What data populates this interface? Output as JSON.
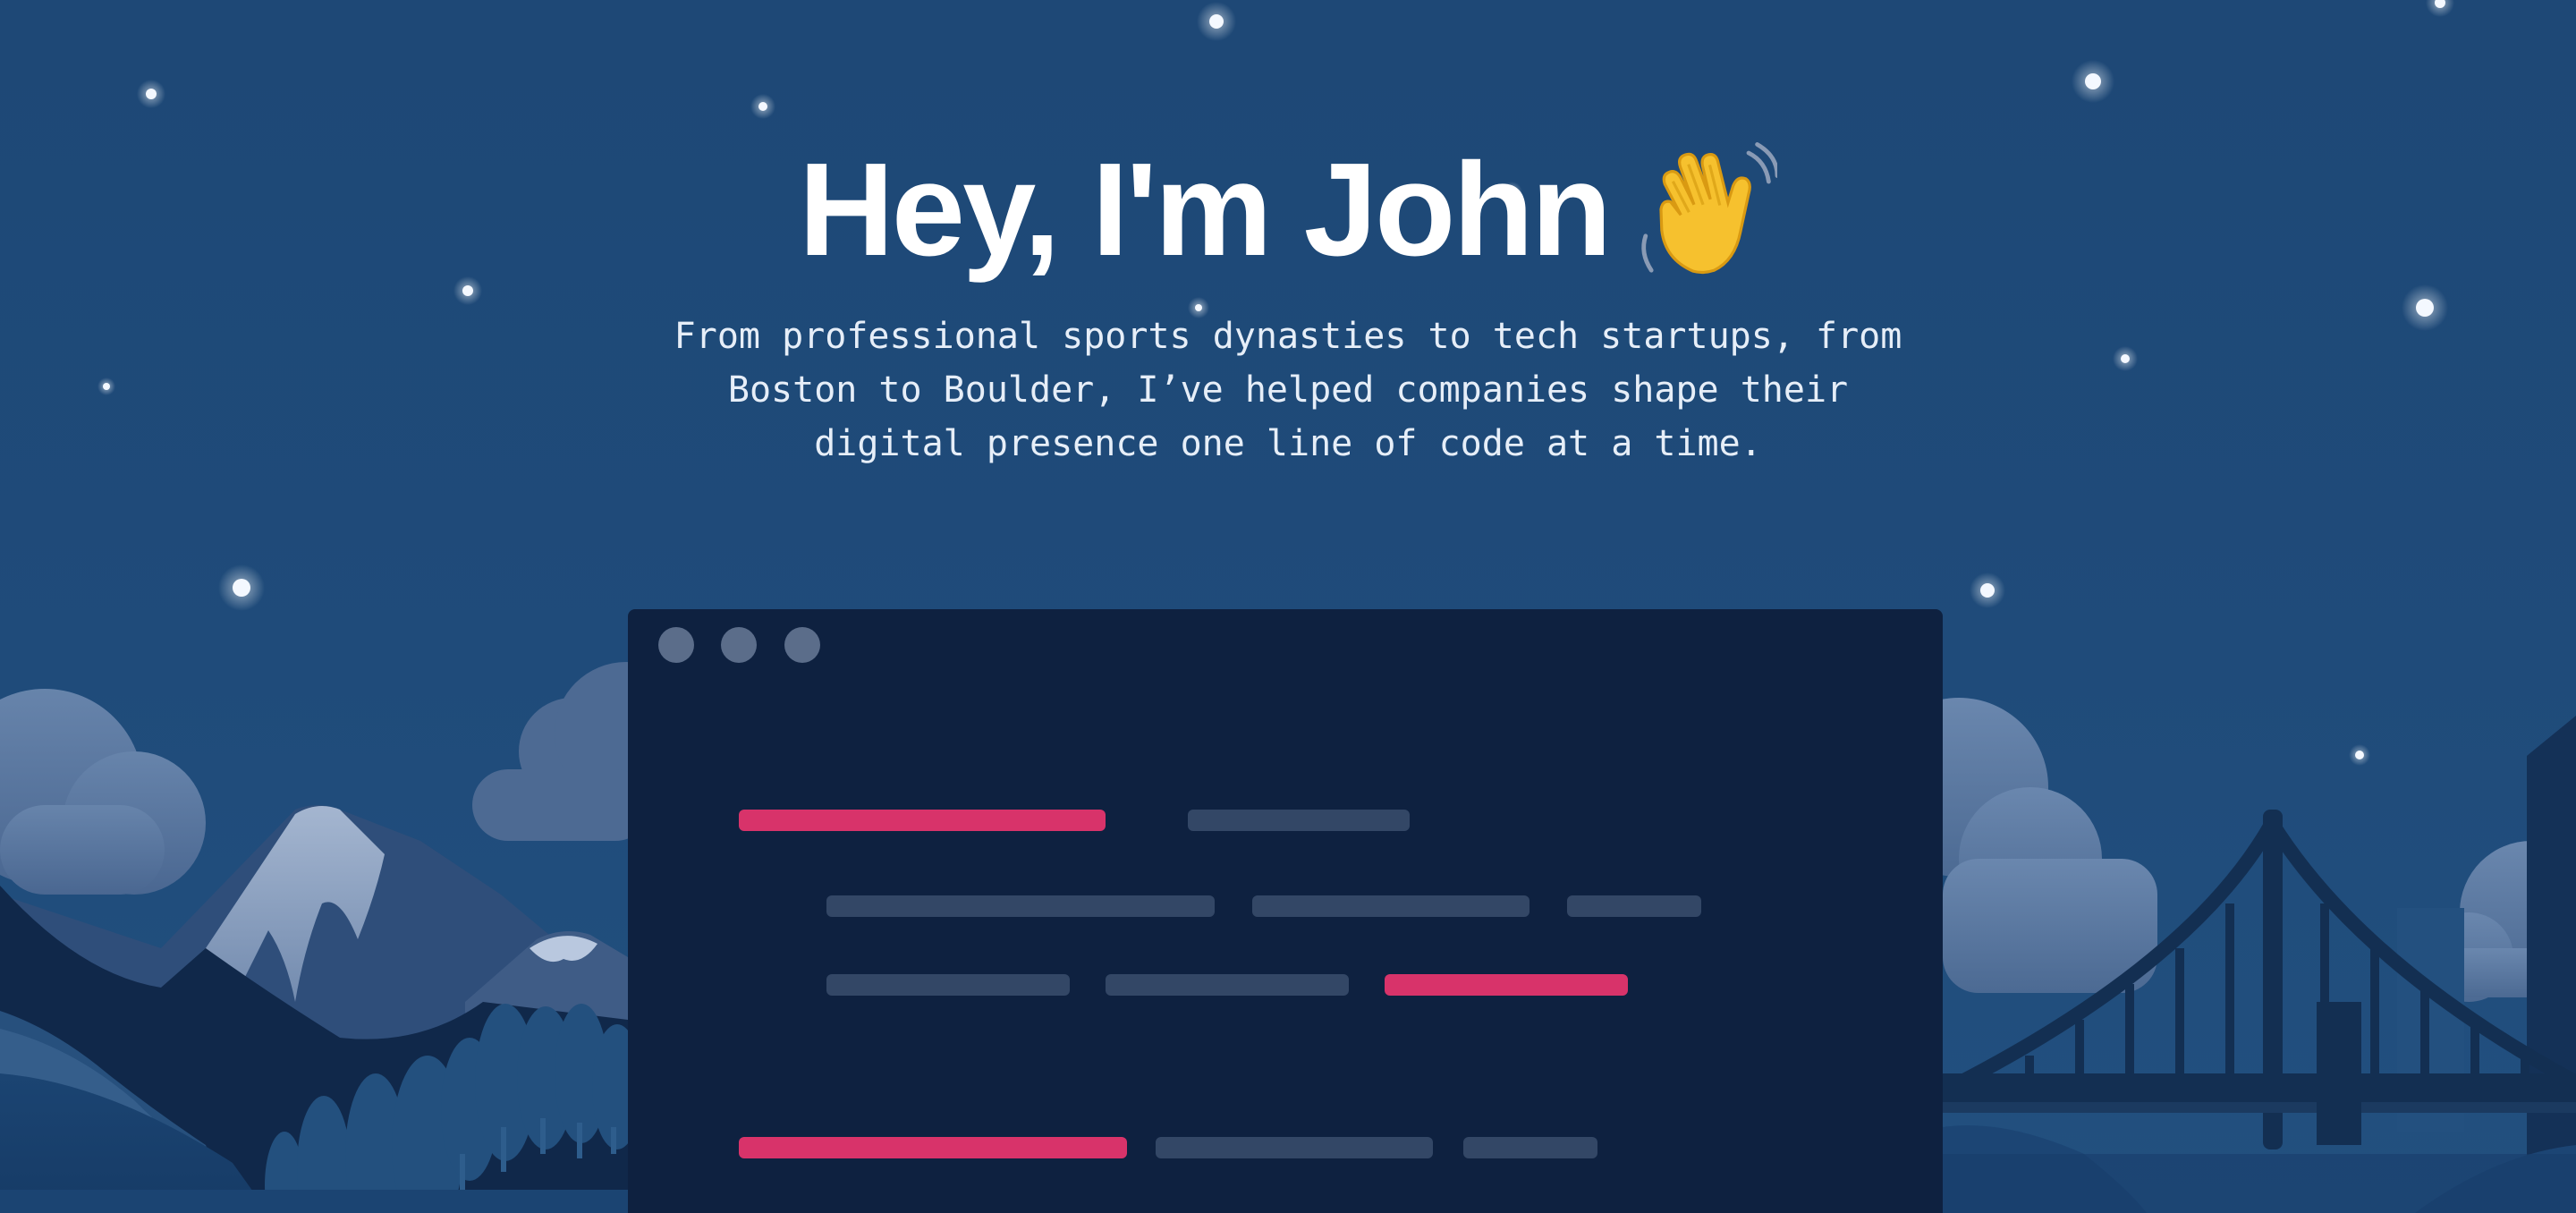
{
  "hero": {
    "headline": "Hey, I'm John",
    "wave_icon": "waving-hand-icon",
    "tagline": "From professional sports dynasties to tech startups, from Boston to Boulder, I’ve helped companies shape their digital presence one line of code at a time."
  },
  "code_window": {
    "window_dots_icon": "window-control-dots-icon"
  },
  "colors": {
    "sky": "#1f4a78",
    "editor_bg": "#0e2140",
    "accent_pink": "#d8336a",
    "muted_line": "#334766",
    "headline_text": "#ffffff"
  }
}
